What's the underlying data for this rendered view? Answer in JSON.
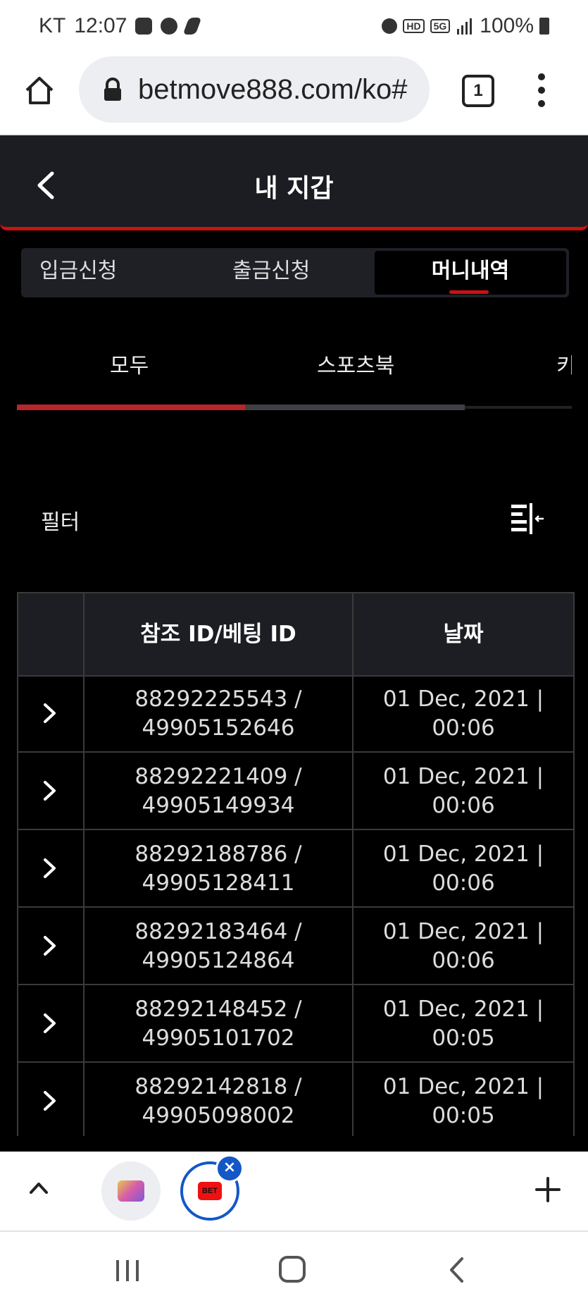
{
  "status_bar": {
    "carrier": "KT",
    "time": "12:07",
    "hd": "HD",
    "network": "5G",
    "battery": "100%"
  },
  "browser": {
    "url": "betmove888.com/ko#",
    "tab_count": "1"
  },
  "header": {
    "title": "내 지갑"
  },
  "wallet_tabs": [
    {
      "label": "입금신청",
      "active": false
    },
    {
      "label": "출금신청",
      "active": false
    },
    {
      "label": "머니내역",
      "active": true
    }
  ],
  "sub_tabs": [
    {
      "label": "모두",
      "active": true
    },
    {
      "label": "스포츠북",
      "active": false
    },
    {
      "label": "키",
      "active": false
    }
  ],
  "filter": {
    "label": "필터"
  },
  "table": {
    "headers": [
      "참조 ID/베팅 ID",
      "날짜"
    ],
    "rows": [
      {
        "ref": "88292225543 /",
        "bet": "49905152646",
        "date": "01 Dec, 2021 |",
        "time": "00:06"
      },
      {
        "ref": "88292221409 /",
        "bet": "49905149934",
        "date": "01 Dec, 2021 |",
        "time": "00:06"
      },
      {
        "ref": "88292188786 /",
        "bet": "49905128411",
        "date": "01 Dec, 2021 |",
        "time": "00:06"
      },
      {
        "ref": "88292183464 /",
        "bet": "49905124864",
        "date": "01 Dec, 2021 |",
        "time": "00:06"
      },
      {
        "ref": "88292148452 /",
        "bet": "49905101702",
        "date": "01 Dec, 2021 |",
        "time": "00:05"
      },
      {
        "ref": "88292142818 /",
        "bet": "49905098002",
        "date": "01 Dec, 2021 |",
        "time": "00:05"
      }
    ]
  },
  "bottom_bar": {
    "tab2_favicon": "BET"
  },
  "colors": {
    "accent_red": "#cc1111",
    "header_bg": "#1b1d22",
    "link_blue": "#1457c7"
  }
}
